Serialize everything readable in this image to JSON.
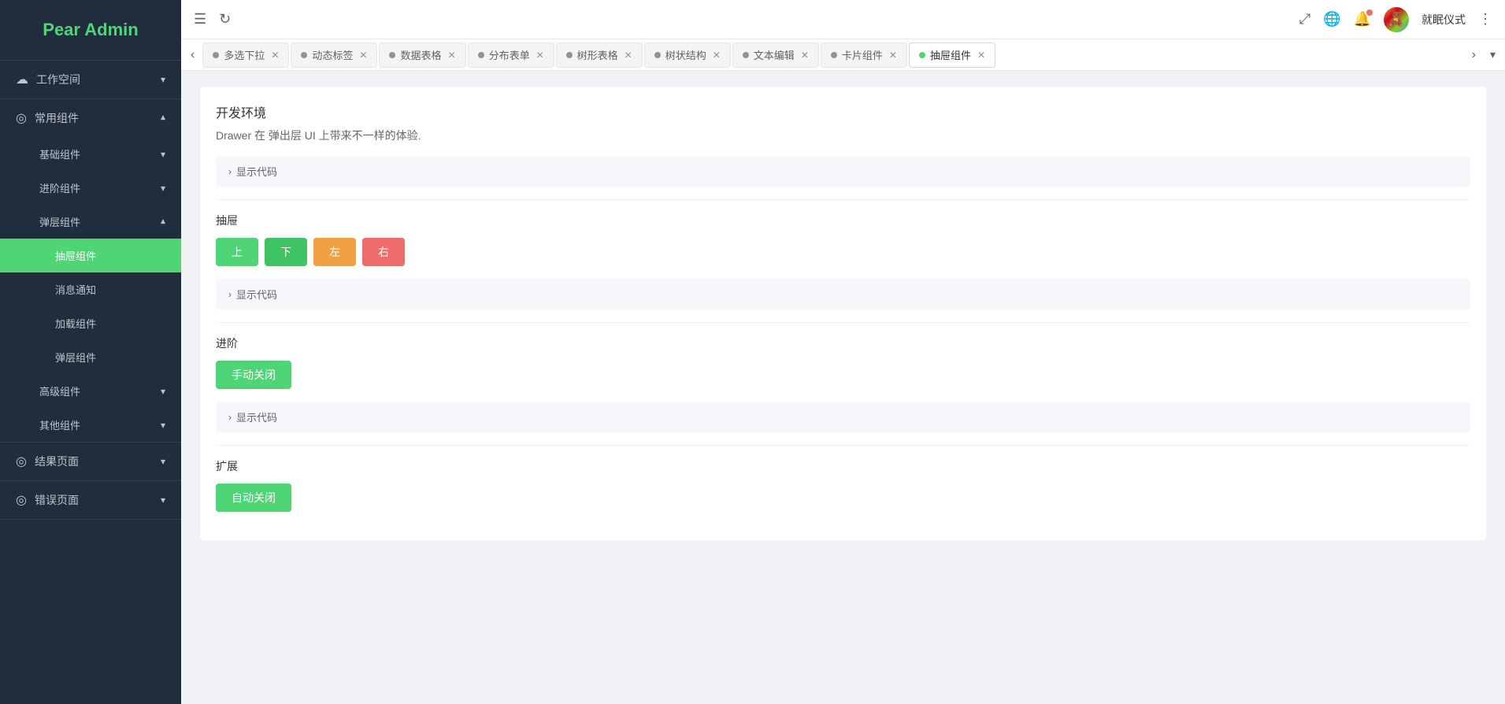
{
  "app": {
    "title": "Pear Admin"
  },
  "topbar": {
    "menu_icon": "☰",
    "refresh_icon": "↻",
    "fullscreen_icon": "⤢",
    "globe_icon": "🌐",
    "bell_icon": "🔔",
    "more_icon": "⋮",
    "user_name": "就眠仪式"
  },
  "tabs": [
    {
      "label": "多选下拉",
      "active": false,
      "dot_active": false
    },
    {
      "label": "动态标签",
      "active": false,
      "dot_active": false
    },
    {
      "label": "数据表格",
      "active": false,
      "dot_active": false
    },
    {
      "label": "分布表单",
      "active": false,
      "dot_active": false
    },
    {
      "label": "树形表格",
      "active": false,
      "dot_active": false
    },
    {
      "label": "树状结构",
      "active": false,
      "dot_active": false
    },
    {
      "label": "文本编辑",
      "active": false,
      "dot_active": false
    },
    {
      "label": "卡片组件",
      "active": false,
      "dot_active": false
    },
    {
      "label": "抽屉组件",
      "active": true,
      "dot_active": true
    }
  ],
  "sidebar": {
    "logo": "Pear Admin",
    "items": [
      {
        "label": "工作空间",
        "icon": "☁",
        "has_children": true,
        "expanded": false
      },
      {
        "label": "常用组件",
        "icon": "◎",
        "has_children": true,
        "expanded": true
      },
      {
        "label": "基础组件",
        "icon": "",
        "has_children": true,
        "expanded": false,
        "sub": true
      },
      {
        "label": "进阶组件",
        "icon": "",
        "has_children": true,
        "expanded": false,
        "sub": true
      },
      {
        "label": "弹层组件",
        "icon": "",
        "has_children": true,
        "expanded": true,
        "sub": true
      },
      {
        "label": "抽屉组件",
        "icon": "",
        "active": true,
        "sub_sub": true
      },
      {
        "label": "消息通知",
        "icon": "",
        "sub_sub": true
      },
      {
        "label": "加载组件",
        "icon": "",
        "sub_sub": true
      },
      {
        "label": "弹层组件",
        "icon": "",
        "sub_sub": true
      },
      {
        "label": "高级组件",
        "icon": "",
        "has_children": true,
        "expanded": false,
        "sub": true
      },
      {
        "label": "其他组件",
        "icon": "",
        "has_children": true,
        "expanded": false,
        "sub": true
      },
      {
        "label": "结果页面",
        "icon": "◎",
        "has_children": true,
        "expanded": false
      },
      {
        "label": "错误页面",
        "icon": "◎",
        "has_children": true,
        "expanded": false
      }
    ]
  },
  "content": {
    "env_label": "开发环境",
    "description": "Drawer 在 弹出层 UI 上带来不一样的体验.",
    "show_code_label": "显示代码",
    "section_basic": {
      "title": "抽屉",
      "buttons": [
        {
          "label": "上",
          "color": "green"
        },
        {
          "label": "下",
          "color": "green"
        },
        {
          "label": "左",
          "color": "orange"
        },
        {
          "label": "右",
          "color": "red"
        }
      ],
      "show_code_label": "显示代码"
    },
    "section_advanced": {
      "title": "进阶",
      "buttons": [
        {
          "label": "手动关闭",
          "color": "green"
        }
      ],
      "show_code_label": "显示代码"
    },
    "section_extend": {
      "title": "扩展",
      "buttons": [
        {
          "label": "自动关闭",
          "color": "green"
        }
      ]
    }
  }
}
